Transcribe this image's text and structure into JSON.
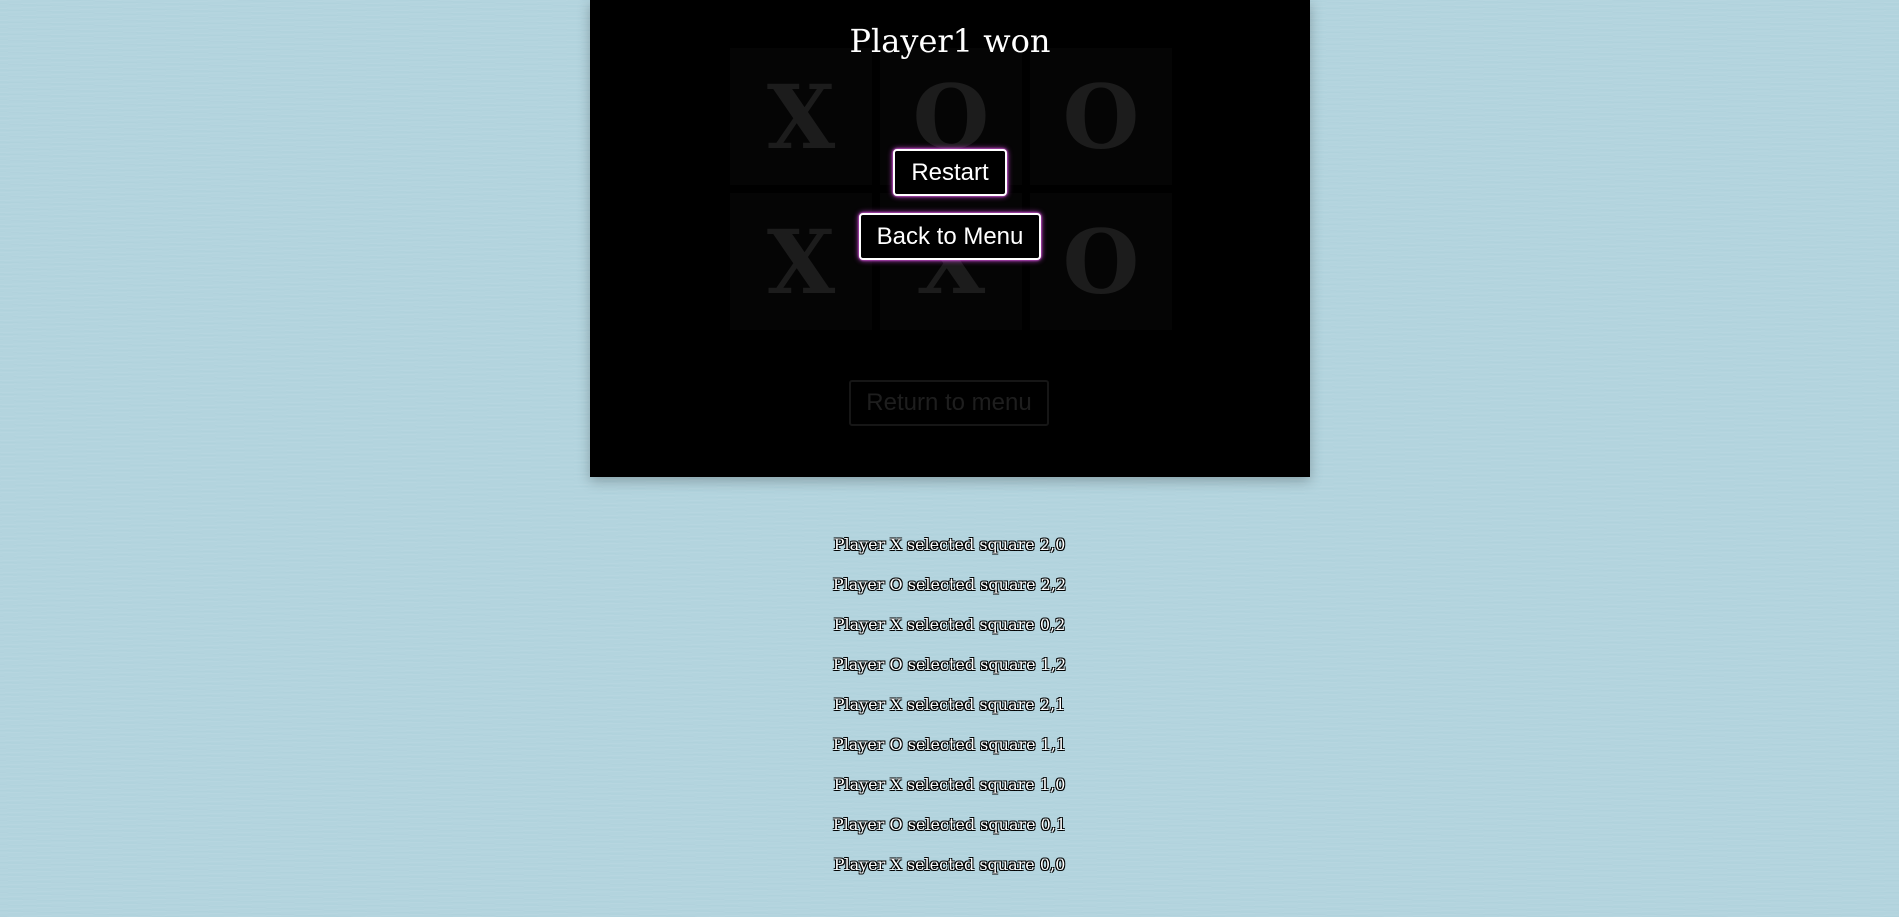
{
  "game": {
    "result_title": "Player1 won",
    "restart_label": "Restart",
    "back_to_menu_label": "Back to Menu",
    "return_to_menu_label": "Return to menu",
    "board": [
      [
        "X",
        "O",
        "O"
      ],
      [
        "X",
        "X",
        "O"
      ]
    ]
  },
  "move_log": [
    "Player X selected square 2,0",
    "Player O selected square 2,2",
    "Player X selected square 0,2",
    "Player O selected square 1,2",
    "Player X selected square 2,1",
    "Player O selected square 1,1",
    "Player X selected square 1,0",
    "Player O selected square 0,1",
    "Player X selected square 0,0"
  ],
  "colors": {
    "background": "#b3d4de",
    "panel": "#000000",
    "button_glow": "#e24cf0",
    "dim_mark": "#1c1c1c"
  }
}
